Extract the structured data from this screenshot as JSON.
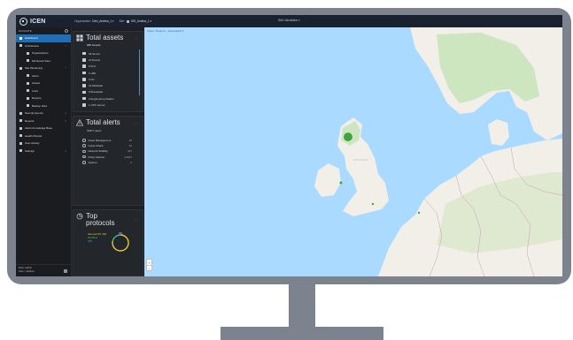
{
  "app": {
    "logo_text": "ICEN"
  },
  "topbar": {
    "organization_label": "Organization:",
    "organization_value": "Cien_Andrea_1 ▾",
    "site_label": "Site:",
    "site_value": "SIS_Andrea_1 ▾",
    "site_calculation": "Site Calculation ▾"
  },
  "sidebar": {
    "header": "NAVIGATE",
    "items": [
      {
        "label": "Dashboard",
        "active": true,
        "sub": false,
        "icon": "home-icon"
      },
      {
        "label": "Architecture",
        "active": false,
        "sub": false,
        "icon": "grid-icon",
        "caret": "^"
      },
      {
        "label": "Organizations",
        "active": false,
        "sub": true,
        "icon": "building-icon"
      },
      {
        "label": "Monitored Sites",
        "active": false,
        "sub": true,
        "icon": "chart-icon"
      },
      {
        "label": "Site Monitoring",
        "active": false,
        "sub": false,
        "icon": "monitor-icon",
        "caret": "^"
      },
      {
        "label": "Alerts",
        "active": false,
        "sub": true,
        "icon": "alert-icon"
      },
      {
        "label": "Assets",
        "active": false,
        "sub": true,
        "icon": "server-icon"
      },
      {
        "label": "Links",
        "active": false,
        "sub": true,
        "icon": "link-icon"
      },
      {
        "label": "Reports",
        "active": false,
        "sub": true,
        "icon": "report-icon"
      },
      {
        "label": "Backup Files",
        "active": false,
        "sub": true,
        "icon": "backup-icon"
      },
      {
        "label": "Security Events",
        "active": false,
        "sub": false,
        "icon": "shield-icon",
        "caret": "v"
      },
      {
        "label": "Reports",
        "active": false,
        "sub": false,
        "icon": "report-icon",
        "caret": "v"
      },
      {
        "label": "Alerts Knowledge Base",
        "active": false,
        "sub": false,
        "icon": "book-icon"
      },
      {
        "label": "Health Monitor",
        "active": false,
        "sub": false,
        "icon": "health-icon"
      },
      {
        "label": "User Activity",
        "active": false,
        "sub": false,
        "icon": "user-icon"
      },
      {
        "label": "Settings",
        "active": false,
        "sub": false,
        "icon": "gear-icon",
        "caret": "v"
      }
    ],
    "footer_role": "Role: admin",
    "footer_user": "User: cuddrea"
  },
  "assets_card": {
    "title": "Total assets",
    "subtitle": "935 Assets",
    "more": "⋯",
    "rows": [
      {
        "label": "46 Server",
        "icon": "server-icon"
      },
      {
        "label": "12 Device",
        "icon": "device-icon"
      },
      {
        "label": "6 PLC",
        "icon": "plc-icon"
      },
      {
        "label": "1 HMI",
        "icon": "hmi-icon"
      },
      {
        "label": "6 I/O",
        "icon": "io-icon"
      },
      {
        "label": "31 Multicast",
        "icon": "multicast-icon"
      },
      {
        "label": "6 Broadcast",
        "icon": "broadcast-icon"
      },
      {
        "label": "2 Engineering Station",
        "icon": "engineering-icon"
      },
      {
        "label": "1 OPC Server",
        "icon": "opc-icon"
      }
    ]
  },
  "alerts_card": {
    "title": "Total alerts",
    "subtitle": "53877 alerts",
    "more": "⋯",
    "rows": [
      {
        "label": "Asset Management",
        "count": "16"
      },
      {
        "label": "Cyber Attack",
        "count": "30"
      },
      {
        "label": "Network Stability",
        "count": "407"
      },
      {
        "label": "Policy Monitor",
        "count": "53407"
      },
      {
        "label": "System",
        "count": "0"
      }
    ]
  },
  "protocols_card": {
    "title_line1": "Top",
    "title_line2": "protocols",
    "more": "⋯",
    "legend": [
      {
        "label": "SiemensS7 400",
        "color": "#e8c53a"
      },
      {
        "label": "ModBus",
        "color": "#3fbf6f"
      },
      {
        "label": "CIP",
        "color": "#5aa8e6"
      }
    ],
    "donut_label": "0%",
    "slices": [
      {
        "label": "SiemensS7 400",
        "fraction": 0.78,
        "color": "#e8c53a"
      },
      {
        "label": "ModBus",
        "fraction": 0.14,
        "color": "#3fbf6f"
      },
      {
        "label": "CIP",
        "fraction": 0.08,
        "color": "#5aa8e6"
      }
    ]
  },
  "map": {
    "breadcrumb": "Cities / Regions - Geographic ▾",
    "zoom_in": "+",
    "zoom_out": "−",
    "colors": {
      "sea": "#aadaff",
      "land": "#f2efe9",
      "forest": "#cde6c0",
      "border": "#c49fb8",
      "marker": "#3ea63e"
    }
  }
}
